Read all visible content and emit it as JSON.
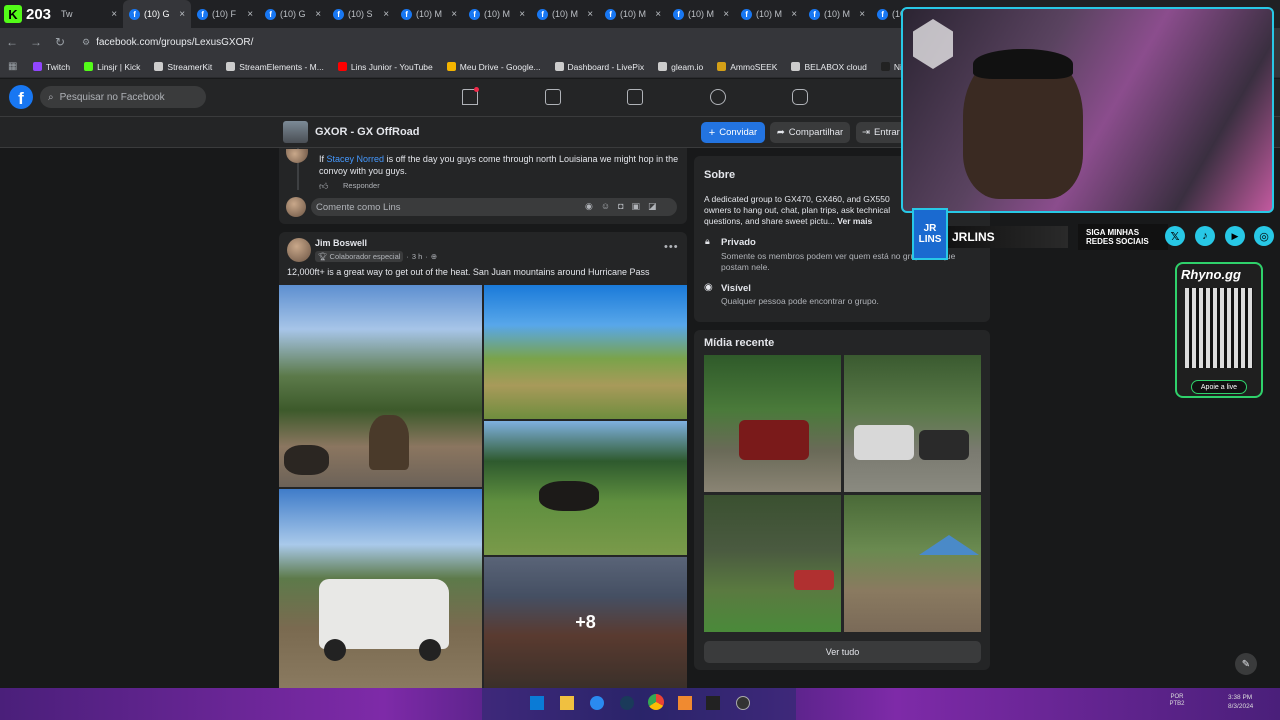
{
  "stream": {
    "viewer_count": "203",
    "overlay_brand": "JRLINS",
    "overlay_follow": "SIGA MINHAS REDES SOCIAIS",
    "rhyno_label": "Rhyno.gg",
    "rhyno_support": "Apoie a live",
    "cam_initials": "JR LINS"
  },
  "browser": {
    "tabs": [
      {
        "label": "Tw"
      },
      {
        "label": "(10) G",
        "active": true
      },
      {
        "label": "(10) F"
      },
      {
        "label": "(10) G"
      },
      {
        "label": "(10) S"
      },
      {
        "label": "(10) M"
      },
      {
        "label": "(10) M"
      },
      {
        "label": "(10) M"
      },
      {
        "label": "(10) M"
      },
      {
        "label": "(10) M"
      },
      {
        "label": "(10) M"
      },
      {
        "label": "(10) M"
      },
      {
        "label": "(10) M"
      }
    ],
    "url": "facebook.com/groups/LexusGXOR/",
    "bookmarks": [
      {
        "label": "Twitch",
        "color": "#9146ff"
      },
      {
        "label": "Linsjr | Kick",
        "color": "#53fc18"
      },
      {
        "label": "StreamerKit",
        "color": "#cccccc"
      },
      {
        "label": "StreamElements - M...",
        "color": "#cccccc"
      },
      {
        "label": "Lins Junior - YouTube",
        "color": "#ff0000"
      },
      {
        "label": "Meu Drive - Google...",
        "color": "#f4b400"
      },
      {
        "label": "Dashboard - LivePix",
        "color": "#cccccc"
      },
      {
        "label": "gleam.io",
        "color": "#cccccc"
      },
      {
        "label": "AmmoSEEK",
        "color": "#d4a017"
      },
      {
        "label": "BELABOX cloud",
        "color": "#cccccc"
      },
      {
        "label": "Nightbot - Comm...",
        "color": "#222222"
      }
    ]
  },
  "facebook": {
    "search_placeholder": "Pesquisar no Facebook",
    "group_name": "GXOR - GX OffRoad",
    "invite_label": "Convidar",
    "share_label": "Compartilhar",
    "enter_label": "Entrar",
    "reply": {
      "prefix": "If",
      "mention": "Stacey Norred",
      "text": "is off the day you guys come through north Louisiana we might hop in the convoy with you guys.",
      "action": "Responder"
    },
    "comment_placeholder": "Comente como Lins",
    "post": {
      "author": "Jim Boswell",
      "badge": "Colaborador especial",
      "time": "3 h",
      "text": "12,000ft+ is a great way to get out of the heat. San Juan mountains around Hurricane Pass",
      "more_photos": "+8"
    },
    "about": {
      "title": "Sobre",
      "description": "A dedicated group to GX470, GX460, and GX550 owners to hang out, chat, plan trips, ask technical questions, and share sweet pictu...",
      "see_more": "Ver mais",
      "private_title": "Privado",
      "private_desc": "Somente os membros podem ver quem está no grupo e o que postam nele.",
      "visible_title": "Visível",
      "visible_desc": "Qualquer pessoa pode encontrar o grupo."
    },
    "media": {
      "title": "Mídia recente",
      "see_all": "Ver tudo"
    }
  },
  "taskbar": {
    "lang": "POR PTB2",
    "time": "3:38 PM",
    "date": "8/3/2024"
  }
}
